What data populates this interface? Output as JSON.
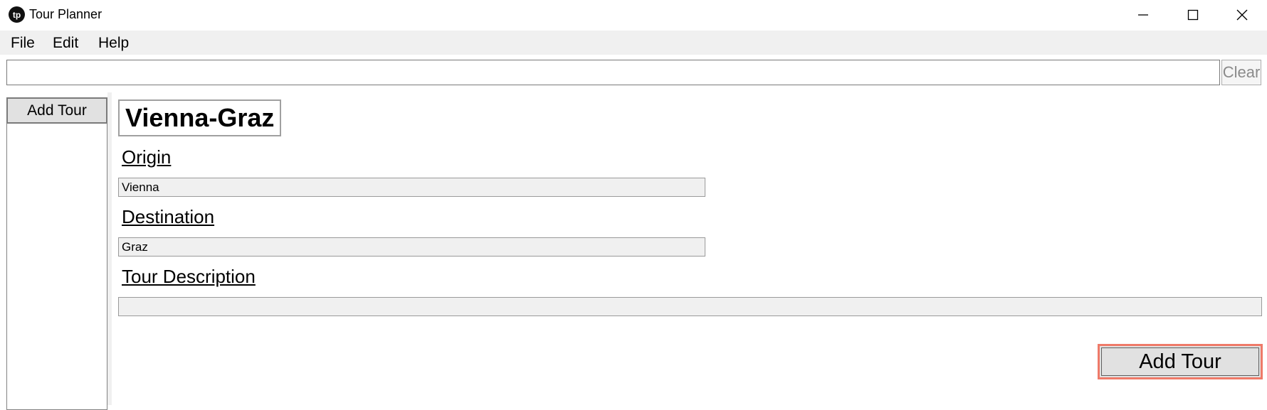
{
  "window": {
    "title": "Tour Planner",
    "icon_text": "tp",
    "controls": [
      "minimize-icon",
      "maximize-icon",
      "close-icon"
    ]
  },
  "menu": {
    "items": [
      {
        "label": "File"
      },
      {
        "label": "Edit"
      },
      {
        "label": "Help"
      }
    ]
  },
  "search": {
    "value": "",
    "placeholder": "",
    "clear_label": "Clear"
  },
  "sidebar": {
    "add_label": "Add Tour",
    "tours": []
  },
  "form": {
    "title": "Vienna-Graz",
    "origin": {
      "label": "Origin",
      "value": "Vienna"
    },
    "destination": {
      "label": "Destination",
      "value": "Graz"
    },
    "description": {
      "label": "Tour Description",
      "value": ""
    },
    "submit_label": "Add Tour"
  },
  "colors": {
    "menubar": "#f0f0f0",
    "button_face": "#e1e1e1",
    "focus_outline": "#ef7a69",
    "field_background": "#f0f0f0"
  }
}
